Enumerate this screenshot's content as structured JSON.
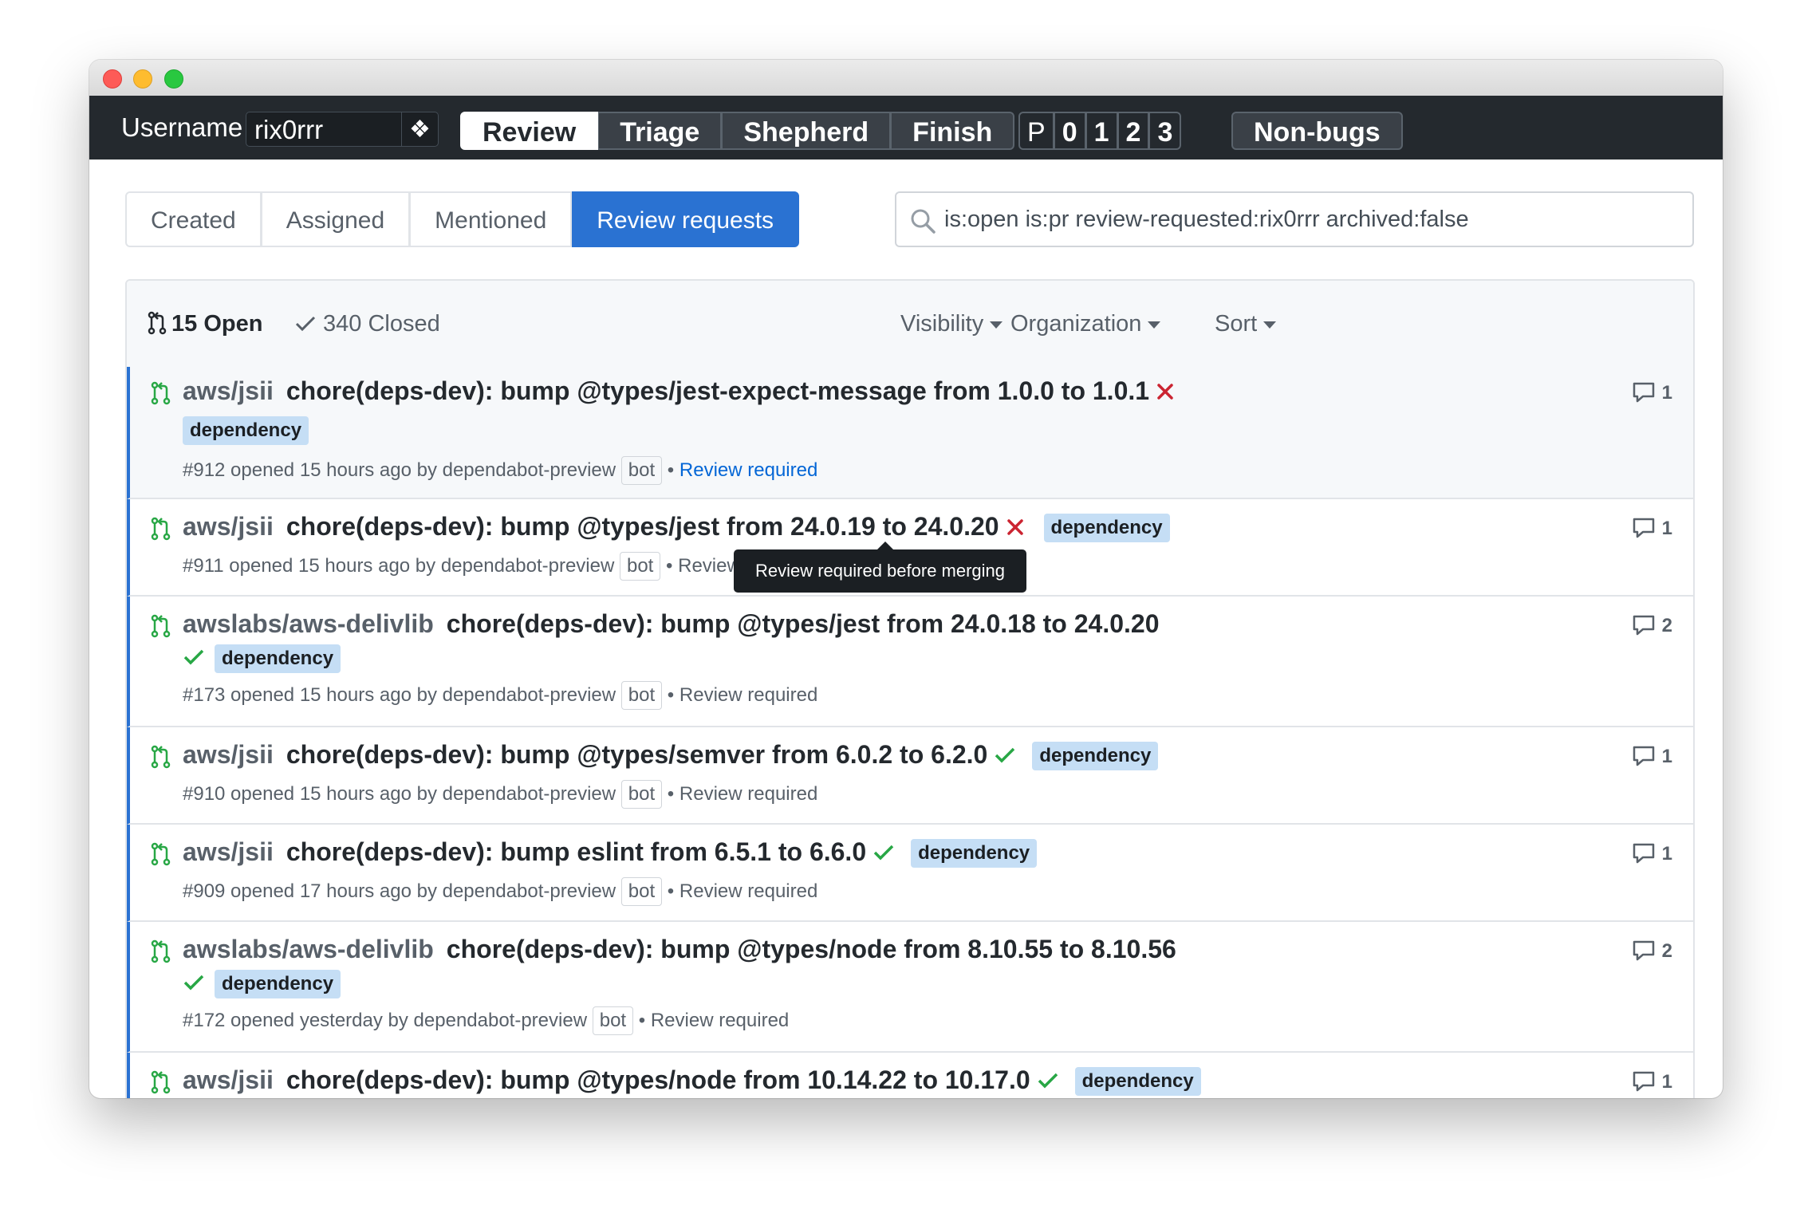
{
  "topbar": {
    "username_label": "Username",
    "username_value": "rix0rrr",
    "username_button_icon": "diamond-icon",
    "modes": [
      "Review",
      "Triage",
      "Shepherd",
      "Finish"
    ],
    "active_mode": "Review",
    "priority_label": "P",
    "priorities": [
      "0",
      "1",
      "2",
      "3"
    ],
    "nonbugs_label": "Non-bugs"
  },
  "tabs": {
    "items": [
      "Created",
      "Assigned",
      "Mentioned",
      "Review requests"
    ],
    "active": "Review requests"
  },
  "search": {
    "value": "is:open is:pr review-requested:rix0rrr archived:false"
  },
  "list_header": {
    "open_label": "15 Open",
    "closed_label": "340 Closed",
    "visibility": "Visibility",
    "organization": "Organization",
    "sort": "Sort"
  },
  "tooltip": "Review required before merging",
  "rows": [
    {
      "repo": "aws/jsii",
      "title": "chore(deps-dev): bump @types/jest-expect-message from 1.0.0 to 1.0.1",
      "status": "fail",
      "label": "dependency",
      "meta": "#912 opened 15 hours ago by dependabot-preview",
      "bot": "bot",
      "review": "Review required",
      "comments": "1"
    },
    {
      "repo": "aws/jsii",
      "title": "chore(deps-dev): bump @types/jest from 24.0.19 to 24.0.20",
      "status": "fail",
      "label": "dependency",
      "meta": "#911 opened 15 hours ago by dependabot-preview",
      "bot": "bot",
      "review": "Review required",
      "comments": "1"
    },
    {
      "repo": "awslabs/aws-delivlib",
      "title": "chore(deps-dev): bump @types/jest from 24.0.18 to 24.0.20",
      "status": "pass",
      "label": "dependency",
      "meta": "#173 opened 15 hours ago by dependabot-preview",
      "bot": "bot",
      "review": "Review required",
      "comments": "2"
    },
    {
      "repo": "aws/jsii",
      "title": "chore(deps-dev): bump @types/semver from 6.0.2 to 6.2.0",
      "status": "pass",
      "label": "dependency",
      "meta": "#910 opened 15 hours ago by dependabot-preview",
      "bot": "bot",
      "review": "Review required",
      "comments": "1"
    },
    {
      "repo": "aws/jsii",
      "title": "chore(deps-dev): bump eslint from 6.5.1 to 6.6.0",
      "status": "pass",
      "label": "dependency",
      "meta": "#909 opened 17 hours ago by dependabot-preview",
      "bot": "bot",
      "review": "Review required",
      "comments": "1"
    },
    {
      "repo": "awslabs/aws-delivlib",
      "title": "chore(deps-dev): bump @types/node from 8.10.55 to 8.10.56",
      "status": "pass",
      "label": "dependency",
      "meta": "#172 opened yesterday by dependabot-preview",
      "bot": "bot",
      "review": "Review required",
      "comments": "2"
    },
    {
      "repo": "aws/jsii",
      "title": "chore(deps-dev): bump @types/node from 10.14.22 to 10.17.0",
      "status": "pass",
      "label": "dependency",
      "comments": "1"
    }
  ],
  "colors": {
    "topbar": "#24292e",
    "accent": "#2a72d2",
    "label_bg": "#c5def5",
    "fail": "#cb2431",
    "pass": "#28a745",
    "pr_open": "#28a745"
  }
}
